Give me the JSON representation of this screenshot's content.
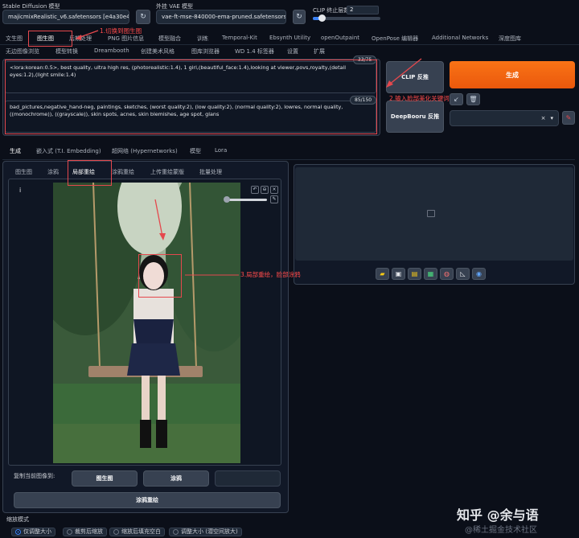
{
  "top": {
    "model_label": "Stable Diffusion 模型",
    "model_value": "majicmixRealistic_v6.safetensors [e4a30e4607]",
    "vae_label": "外挂 VAE 模型",
    "vae_value": "vae-ft-mse-840000-ema-pruned.safetensors",
    "clip_label": "CLIP 终止层数",
    "clip_value": "2"
  },
  "main_tabs": [
    "文生图",
    "图生图",
    "后期处理",
    "PNG 图片信息",
    "模型融合",
    "训练",
    "Temporal-Kit",
    "Ebsynth Utility",
    "openOutpaint",
    "OpenPose 编辑器",
    "Additional Networks",
    "深度图库"
  ],
  "main_tabs_row2": [
    "无边图像浏览",
    "模型转换",
    "Dreambooth",
    "创建美术风格",
    "图库浏览器",
    "WD 1.4 标签器",
    "设置",
    "扩展"
  ],
  "prompt": {
    "positive": "<lora:korean:0.5>, best quality, ultra high res, (photorealistic:1.4), 1 girl,(beautiful_face:1.4),looking at viewer,povs,royalty,(detail eyes:1.2),(light smile:1.4)",
    "positive_count": "33/75",
    "negative": "bad_pictures,negative_hand-neg, paintings, sketches, (worst quality:2), (low quality:2), (normal quality:2), lowres, normal quality, ((monochrome)), ((grayscale)), skin spots, acnes, skin blemishes, age spot, glans",
    "negative_count": "85/150"
  },
  "buttons": {
    "clip_interrogate": "CLIP 反推",
    "deepbooru": "DeepBooru 反推",
    "generate": "生成",
    "copy_to_img2img": "图生图",
    "copy_to_sketch": "涂鸦",
    "copy_to_inpaint_sketch": "涂鸦重绘"
  },
  "sub_tabs": [
    "生成",
    "嵌入式 (T.I. Embedding)",
    "超网络 (Hypernetworks)",
    "模型",
    "Lora"
  ],
  "img_tabs": [
    "图生图",
    "涂鸦",
    "局部重绘",
    "涂鸦重绘",
    "上传重绘蒙版",
    "批量处理"
  ],
  "copy_label": "复制当前图像到:",
  "resize_label": "缩放模式",
  "resize_options": [
    "仅调整大小",
    "裁剪后缩放",
    "缩放后填充空白",
    "调整大小 (潜空间放大)"
  ],
  "annotations": {
    "a1": "1.切换到图生图",
    "a2": "2.输入脸部美化关键词",
    "a3": "3.局部重绘，脸部涂鸦"
  },
  "watermark": {
    "main": "知乎 @余与语",
    "sub": "@稀土掘金技术社区"
  },
  "colors": {
    "background": "#0b0f19",
    "accent_orange": "#f97316",
    "annotation_red": "#ff4b4b"
  }
}
